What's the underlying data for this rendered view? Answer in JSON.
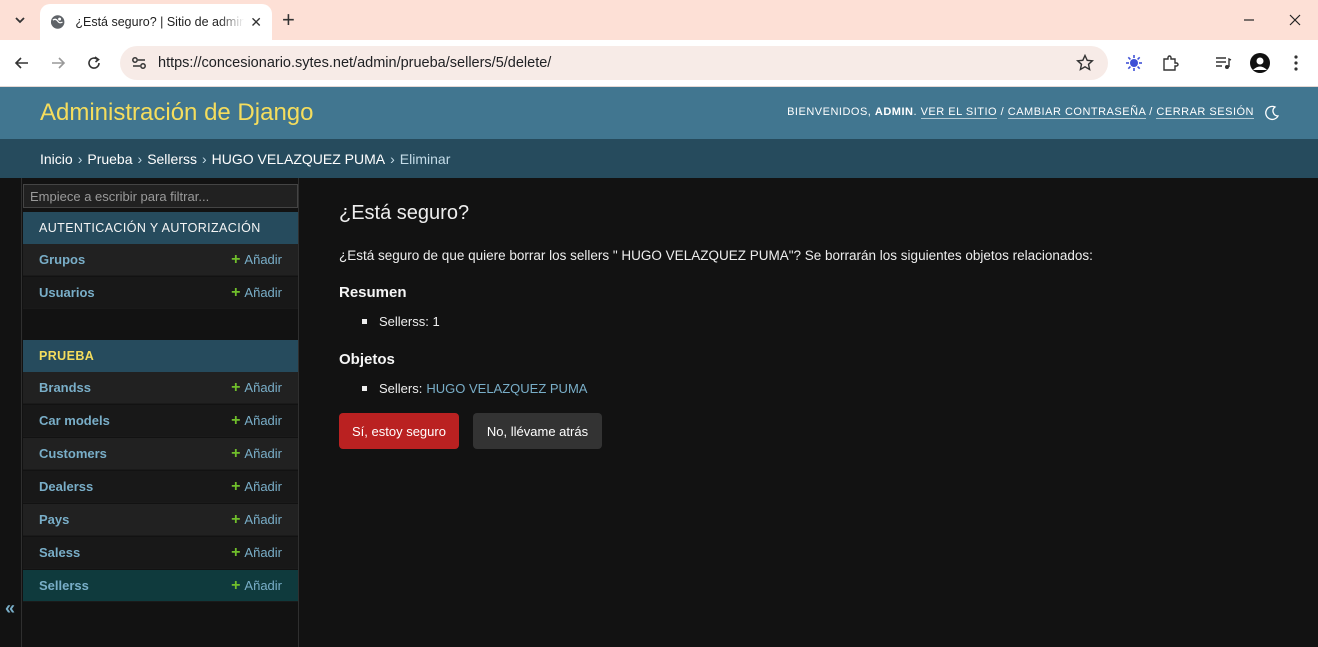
{
  "browser": {
    "tab_title": "¿Está seguro? | Sitio de administración",
    "url": "https://concesionario.sytes.net/admin/prueba/sellers/5/delete/"
  },
  "header": {
    "branding": "Administración de Django",
    "welcome": "Bienvenidos,",
    "user": "admin",
    "view_site": "Ver el sitio",
    "change_password": "Cambiar contraseña",
    "logout": "Cerrar sesión"
  },
  "breadcrumbs": [
    "Inicio",
    "Prueba",
    "Sellerss",
    "HUGO VELAZQUEZ PUMA",
    "Eliminar"
  ],
  "sidebar": {
    "filter_placeholder": "Empiece a escribir para filtrar...",
    "modules": [
      {
        "caption": "Autenticación y autorización",
        "models": [
          {
            "name": "Grupos",
            "add": "Añadir"
          },
          {
            "name": "Usuarios",
            "add": "Añadir"
          }
        ]
      },
      {
        "caption": "Prueba",
        "models": [
          {
            "name": "Brandss",
            "add": "Añadir"
          },
          {
            "name": "Car models",
            "add": "Añadir"
          },
          {
            "name": "Customers",
            "add": "Añadir"
          },
          {
            "name": "Dealerss",
            "add": "Añadir"
          },
          {
            "name": "Pays",
            "add": "Añadir"
          },
          {
            "name": "Saless",
            "add": "Añadir"
          },
          {
            "name": "Sellerss",
            "add": "Añadir"
          }
        ]
      }
    ],
    "collapse_label": "«"
  },
  "content": {
    "title": "¿Está seguro?",
    "question": "¿Está seguro de que quiere borrar los sellers \" HUGO VELAZQUEZ PUMA\"? Se borrarán los siguientes objetos relacionados:",
    "summary_heading": "Resumen",
    "summary_item": "Sellerss: 1",
    "objects_heading": "Objetos",
    "object_prefix": "Sellers:",
    "object_link": "HUGO VELAZQUEZ PUMA",
    "confirm_button": "Sí, estoy seguro",
    "cancel_button": "No, llévame atrás"
  },
  "colors": {
    "header_bg": "#417690",
    "breadcrumbs_bg": "#264b5d",
    "branding": "#f5dd5d",
    "link": "#79aec8",
    "danger": "#ba2121",
    "add_plus": "#70bf2b"
  }
}
